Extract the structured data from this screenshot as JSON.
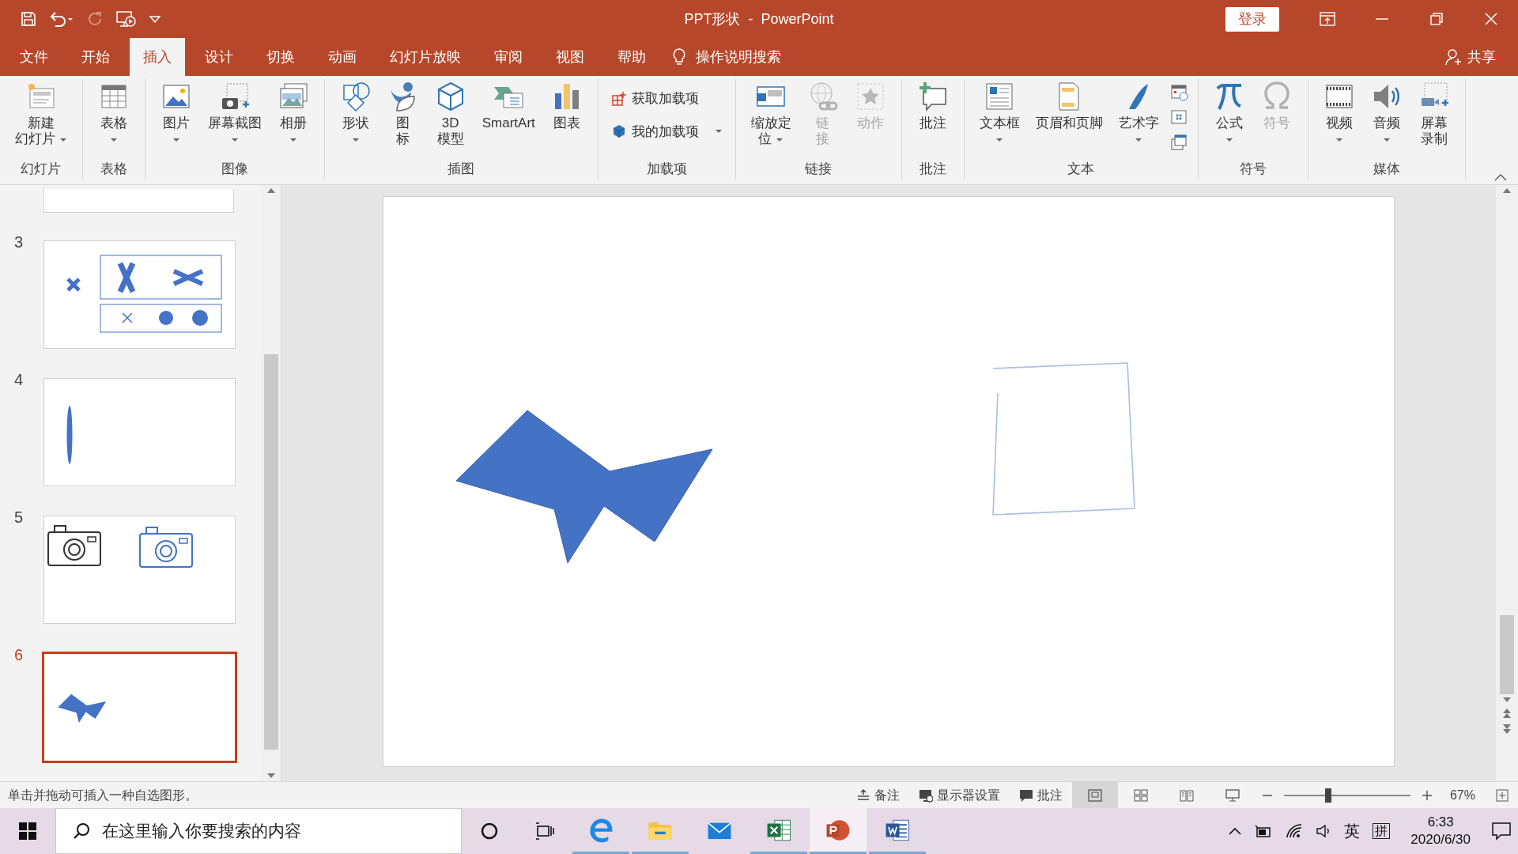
{
  "title_bar": {
    "title": "PPT形状  -  PowerPoint",
    "login_button": "登录"
  },
  "menu_tabs": [
    {
      "label": "文件",
      "selected": false
    },
    {
      "label": "开始",
      "selected": false
    },
    {
      "label": "插入",
      "selected": true
    },
    {
      "label": "设计",
      "selected": false
    },
    {
      "label": "切换",
      "selected": false
    },
    {
      "label": "动画",
      "selected": false
    },
    {
      "label": "幻灯片放映",
      "selected": false
    },
    {
      "label": "审阅",
      "selected": false
    },
    {
      "label": "视图",
      "selected": false
    },
    {
      "label": "帮助",
      "selected": false
    }
  ],
  "tell_me": "操作说明搜索",
  "share": "共享",
  "ribbon_groups": [
    {
      "label": "幻灯片",
      "commands": [
        {
          "kind": "large",
          "lines": [
            "新建",
            "幻灯片"
          ],
          "dropdown": true,
          "disabled": false
        }
      ]
    },
    {
      "label": "表格",
      "commands": [
        {
          "kind": "large",
          "lines": [
            "表格"
          ],
          "dropdown": true,
          "disabled": false
        }
      ]
    },
    {
      "label": "图像",
      "commands": [
        {
          "kind": "large",
          "lines": [
            "图片"
          ],
          "dropdown": true,
          "disabled": false
        },
        {
          "kind": "large",
          "lines": [
            "屏幕截图"
          ],
          "dropdown": true,
          "disabled": false
        },
        {
          "kind": "large",
          "lines": [
            "相册"
          ],
          "dropdown": true,
          "disabled": false
        }
      ]
    },
    {
      "label": "插图",
      "commands": [
        {
          "kind": "large",
          "lines": [
            "形状"
          ],
          "dropdown": true,
          "disabled": false
        },
        {
          "kind": "large",
          "lines": [
            "图",
            "标"
          ],
          "dropdown": false,
          "disabled": false
        },
        {
          "kind": "large",
          "lines": [
            "3D",
            "模型"
          ],
          "dropdown": false,
          "disabled": false
        },
        {
          "kind": "large",
          "lines": [
            "SmartArt"
          ],
          "dropdown": false,
          "disabled": false
        },
        {
          "kind": "large",
          "lines": [
            "图表"
          ],
          "dropdown": false,
          "disabled": false
        }
      ]
    },
    {
      "label": "加载项",
      "commands": [
        {
          "kind": "small",
          "lines": [
            "获取加载项"
          ],
          "dropdown": false,
          "disabled": false
        },
        {
          "kind": "small",
          "lines": [
            "我的加载项"
          ],
          "dropdown": true,
          "disabled": false
        }
      ]
    },
    {
      "label": "链接",
      "commands": [
        {
          "kind": "large",
          "lines": [
            "缩放定",
            "位"
          ],
          "dropdown": true,
          "disabled": false
        },
        {
          "kind": "large",
          "lines": [
            "链",
            "接"
          ],
          "dropdown": false,
          "disabled": true
        },
        {
          "kind": "large",
          "lines": [
            "动作"
          ],
          "dropdown": false,
          "disabled": true
        }
      ]
    },
    {
      "label": "批注",
      "commands": [
        {
          "kind": "large",
          "lines": [
            "批注"
          ],
          "dropdown": false,
          "disabled": false
        }
      ]
    },
    {
      "label": "文本",
      "commands": [
        {
          "kind": "large",
          "lines": [
            "文本框"
          ],
          "dropdown": true,
          "disabled": false
        },
        {
          "kind": "large",
          "lines": [
            "页眉和页脚"
          ],
          "dropdown": false,
          "disabled": false
        },
        {
          "kind": "large",
          "lines": [
            "艺术字"
          ],
          "dropdown": true,
          "disabled": false
        },
        {
          "kind": "mini",
          "dropdown": false,
          "disabled": false
        },
        {
          "kind": "mini",
          "dropdown": false,
          "disabled": false
        },
        {
          "kind": "mini",
          "dropdown": false,
          "disabled": false
        }
      ]
    },
    {
      "label": "符号",
      "commands": [
        {
          "kind": "large",
          "lines": [
            "公式"
          ],
          "dropdown": true,
          "disabled": false
        },
        {
          "kind": "large",
          "lines": [
            "符号"
          ],
          "dropdown": false,
          "disabled": true
        }
      ]
    },
    {
      "label": "媒体",
      "commands": [
        {
          "kind": "large",
          "lines": [
            "视频"
          ],
          "dropdown": true,
          "disabled": false
        },
        {
          "kind": "large",
          "lines": [
            "音频"
          ],
          "dropdown": true,
          "disabled": false
        },
        {
          "kind": "large",
          "lines": [
            "屏幕",
            "录制"
          ],
          "dropdown": false,
          "disabled": false
        }
      ]
    }
  ],
  "slides_panel": {
    "clipped_top_slide": true,
    "slides": [
      {
        "number": "3",
        "selected": false
      },
      {
        "number": "4",
        "selected": false
      },
      {
        "number": "5",
        "selected": false
      },
      {
        "number": "6",
        "selected": true
      }
    ]
  },
  "slide_canvas": {
    "shapes": [
      {
        "kind": "freeform"
      },
      {
        "kind": "outline"
      }
    ]
  },
  "status_bar": {
    "message": "单击并拖动可插入一种自选图形。",
    "buttons": [
      {
        "label": "备注"
      },
      {
        "label": "显示器设置"
      },
      {
        "label": "批注"
      }
    ],
    "views": [
      {
        "selected": true
      },
      {
        "selected": false
      },
      {
        "selected": false
      },
      {
        "selected": false
      }
    ],
    "zoom": {
      "level": 0.35,
      "reading": "67%"
    }
  },
  "taskbar": {
    "search_placeholder": "在这里输入你要搜索的内容",
    "apps": [
      {
        "running": true,
        "selected": false
      },
      {
        "running": true,
        "selected": false
      },
      {
        "running": false,
        "selected": false
      },
      {
        "running": true,
        "selected": false
      },
      {
        "running": true,
        "selected": true
      },
      {
        "running": true,
        "selected": false
      }
    ],
    "input_mode": "英",
    "ime": "拼",
    "time": "6:33",
    "date": "2020/6/30"
  }
}
